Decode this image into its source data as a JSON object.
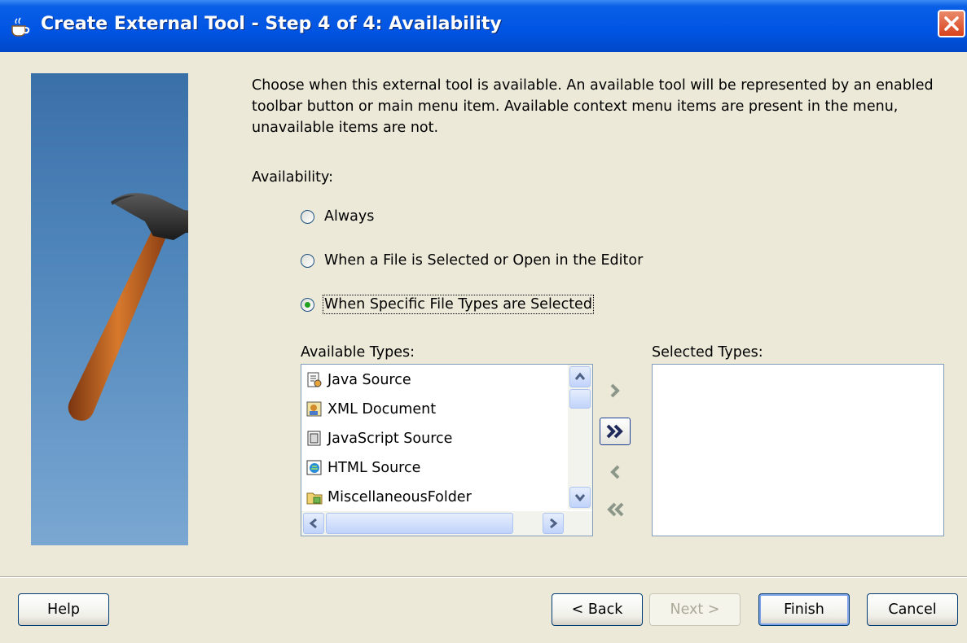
{
  "window": {
    "title": "Create External Tool - Step 4 of 4: Availability",
    "title_icon": "coffee-cup-icon",
    "close_icon": "close-icon"
  },
  "intro_text": "Choose when this external tool is available. An available tool will be represented by an enabled toolbar button or main menu item. Available context menu items are present in the menu, unavailable items are not.",
  "availability": {
    "label": "Availability:",
    "options": [
      {
        "label": "Always",
        "checked": false
      },
      {
        "label": "When a File is Selected or Open in the Editor",
        "checked": false
      },
      {
        "label": "When Specific File Types are Selected",
        "checked": true
      }
    ]
  },
  "available_types": {
    "label": "Available Types:",
    "items": [
      {
        "label": "Java Source",
        "icon": "java-source-icon"
      },
      {
        "label": "XML Document",
        "icon": "xml-document-icon"
      },
      {
        "label": "JavaScript Source",
        "icon": "javascript-source-icon"
      },
      {
        "label": "HTML Source",
        "icon": "html-source-icon"
      },
      {
        "label": "MiscellaneousFolder",
        "icon": "folder-icon"
      }
    ]
  },
  "selected_types": {
    "label": "Selected Types:",
    "items": []
  },
  "shuttle_buttons": {
    "add": ">",
    "add_all": ">>",
    "remove": "<",
    "remove_all": "<<"
  },
  "buttons": {
    "help": "Help",
    "back": "< Back",
    "next": "Next >",
    "finish": "Finish",
    "cancel": "Cancel"
  },
  "colors": {
    "titlebar": "#0054e3",
    "dialog_bg": "#ece9d8",
    "banner": "#4f86bb",
    "radio_dot": "#21a121"
  }
}
